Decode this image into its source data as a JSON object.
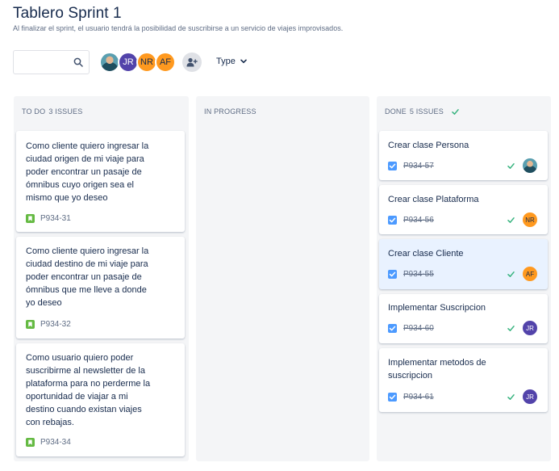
{
  "header": {
    "title": "Tablero Sprint 1",
    "subtitle": "Al finalizar el sprint, el usuario tendrá la posibilidad de suscribirse a un servicio de viajes improvisados."
  },
  "toolbar": {
    "search_value": "",
    "avatars": [
      {
        "initials": "",
        "kind": "photo"
      },
      {
        "initials": "JR",
        "color": "#5243aa"
      },
      {
        "initials": "NR",
        "color": "#ff991f"
      },
      {
        "initials": "AF",
        "color": "#ff991f"
      }
    ],
    "filter_label": "Type"
  },
  "colors": {
    "story_green": "#65ba43",
    "done_blue": "#4c9aff",
    "done_check": "#36b37e",
    "column_bg": "#f4f5f7",
    "selected_card": "#e9f2ff"
  },
  "columns": {
    "todo": {
      "name": "TO DO",
      "count": "3 ISSUES",
      "cards": [
        {
          "title_lines": [
            "Como cliente quiero ingresar la",
            "ciudad origen de mi viaje para",
            "poder encontrar un pasaje de",
            "ómnibus cuyo origen sea el",
            "mismo que yo deseo"
          ],
          "key": "P934-31",
          "icon": "story-icon"
        },
        {
          "title_lines": [
            "Como cliente quiero ingresar la",
            "ciudad destino de mi viaje para",
            "poder encontrar un pasaje de",
            "ómnibus que me lleve a donde",
            "yo deseo"
          ],
          "key": "P934-32",
          "icon": "story-icon"
        },
        {
          "title_lines": [
            "Como usuario quiero poder",
            "suscribirme al newsletter de la",
            "plataforma para no perderme la",
            "oportunidad de viajar a mi",
            "destino cuando existan viajes",
            "con rebajas."
          ],
          "key": "P934-34",
          "icon": "story-icon"
        }
      ]
    },
    "progress": {
      "name": "IN PROGRESS",
      "count": "",
      "cards": []
    },
    "done": {
      "name": "DONE",
      "count": "5 ISSUES",
      "cards": [
        {
          "title_lines": [
            "Crear clase Persona"
          ],
          "key": "P934-57",
          "assignee": "",
          "assignee_kind": "photo"
        },
        {
          "title_lines": [
            "Crear clase Plataforma"
          ],
          "key": "P934-56",
          "assignee": "NR",
          "assignee_color": "#ff991f"
        },
        {
          "title_lines": [
            "Crear clase Cliente"
          ],
          "key": "P934-55",
          "assignee": "AF",
          "assignee_color": "#ff991f",
          "selected": true
        },
        {
          "title_lines": [
            "Implementar Suscripcion"
          ],
          "key": "P934-60",
          "assignee": "JR",
          "assignee_color": "#5243aa"
        },
        {
          "title_lines": [
            "Implementar metodos de",
            "suscripcion"
          ],
          "key": "P934-61",
          "assignee": "JR",
          "assignee_color": "#5243aa"
        }
      ]
    }
  }
}
